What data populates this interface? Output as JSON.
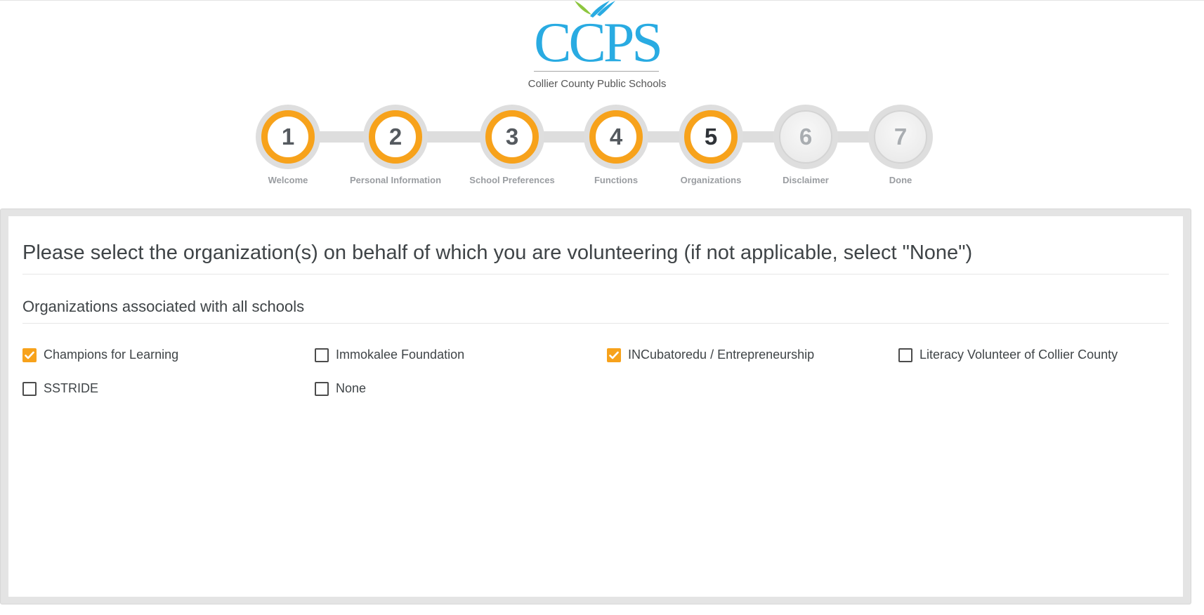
{
  "logo": {
    "wordmark": "CCPS",
    "subtitle": "Collier County Public Schools",
    "colors": {
      "wordmark": "#29abe2",
      "leaf_green": "#8dc63f",
      "leaf_blue": "#29abe2"
    }
  },
  "progress": {
    "accent_color": "#f7a21b",
    "steps": [
      {
        "number": "1",
        "label": "Welcome",
        "state": "done"
      },
      {
        "number": "2",
        "label": "Personal Information",
        "state": "done"
      },
      {
        "number": "3",
        "label": "School Preferences",
        "state": "done"
      },
      {
        "number": "4",
        "label": "Functions",
        "state": "done"
      },
      {
        "number": "5",
        "label": "Organizations",
        "state": "active"
      },
      {
        "number": "6",
        "label": "Disclaimer",
        "state": "todo"
      },
      {
        "number": "7",
        "label": "Done",
        "state": "todo"
      }
    ]
  },
  "form": {
    "heading": "Please select the organization(s) on behalf of which you are volunteering (if not applicable, select \"None\")",
    "section_title": "Organizations associated with all schools",
    "options": [
      {
        "label": "Champions for Learning",
        "checked": true
      },
      {
        "label": "Immokalee Foundation",
        "checked": false
      },
      {
        "label": "INCubatoredu / Entrepreneurship",
        "checked": true
      },
      {
        "label": "Literacy Volunteer of Collier County",
        "checked": false
      },
      {
        "label": "SSTRIDE",
        "checked": false
      },
      {
        "label": "None",
        "checked": false
      }
    ]
  }
}
